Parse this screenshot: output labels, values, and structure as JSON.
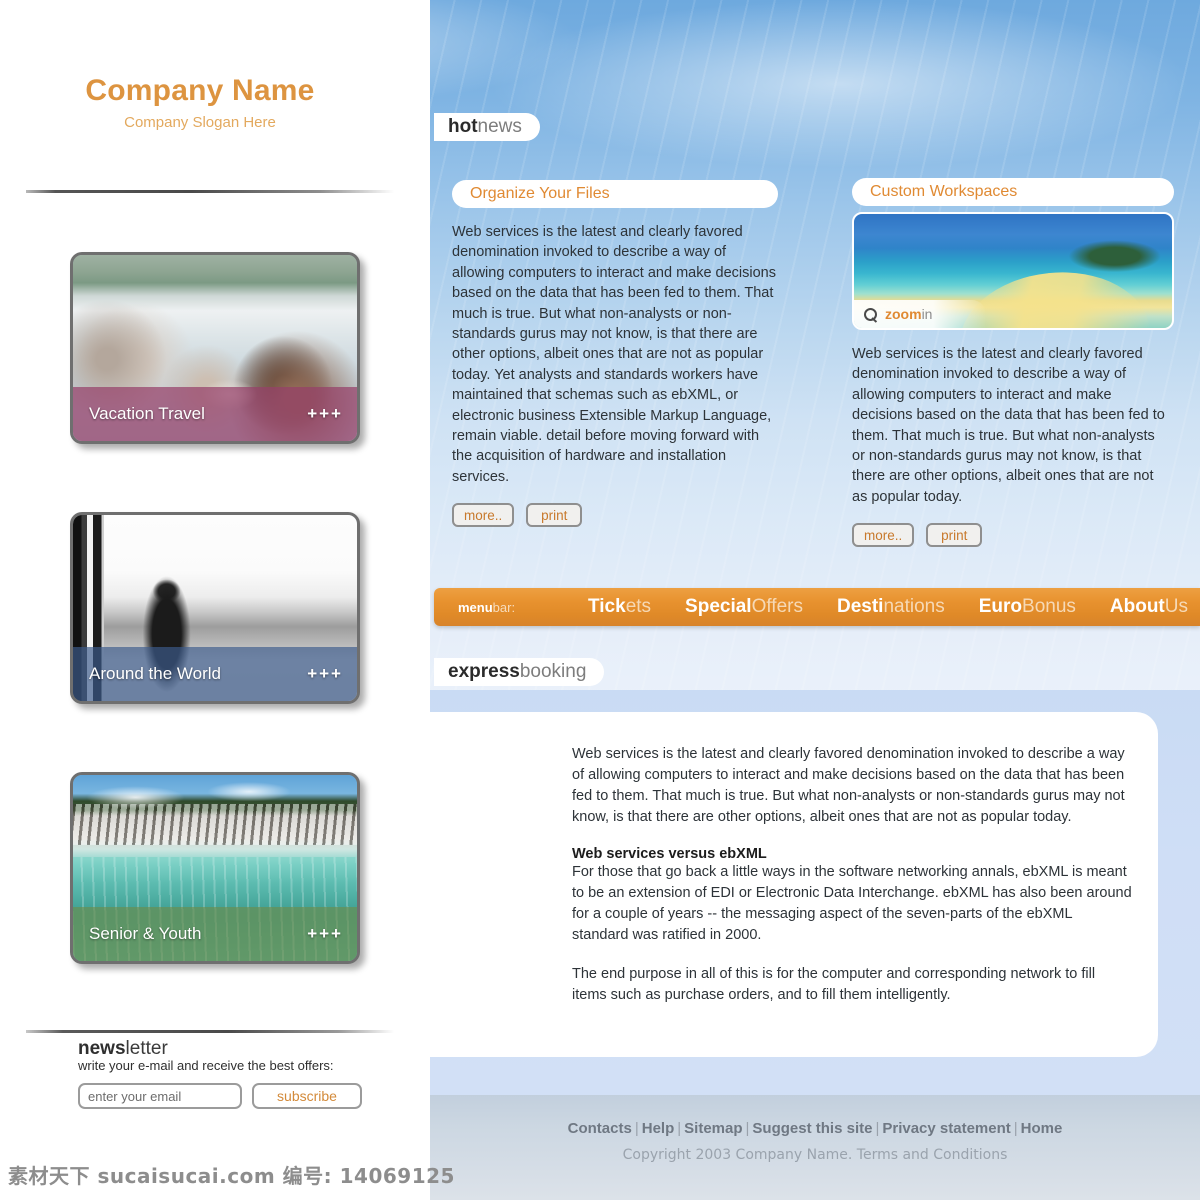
{
  "brand": {
    "name": "Company Name",
    "slogan": "Company Slogan Here",
    "name_color": "#dd9440",
    "slogan_color": "#e3a95e"
  },
  "sidebar": {
    "cards": [
      {
        "label": "Vacation Travel",
        "more": "+++",
        "band_color": "#96406a",
        "image": "lake-with-people-photo"
      },
      {
        "label": "Around the World",
        "more": "+++",
        "band_color": "#3c5c8c",
        "image": "man-at-railing-snow-photo"
      },
      {
        "label": "Senior & Youth",
        "more": "+++",
        "band_color": "#6e8c48",
        "image": "tropical-rocks-turquoise-water-photo"
      }
    ],
    "newsletter": {
      "title_bold": "news",
      "title_rest": "letter",
      "subtitle": "write your e-mail and receive the best offers:",
      "input_value": "enter your email",
      "input_placeholder": "enter your email",
      "button_label": "subscribe",
      "button_color": "#d38a3a"
    }
  },
  "watermark": "素材天下 sucaisucai.com 编号: 14069125",
  "hotnews": {
    "tab_bold": "hot",
    "tab_rest": "news",
    "left": {
      "heading": "Organize Your Files",
      "body": "Web services is the latest and clearly favored denomination invoked to describe a way of allowing computers to interact and make decisions based on the data that has been fed to them. That much is true. But what non-analysts or non-standards gurus may not know, is that there are other options, albeit ones that are not as popular today. Yet analysts and standards workers have maintained that schemas such as ebXML, or electronic business Extensible Markup Language, remain viable. detail before moving forward with the acquisition of hardware and installation services.",
      "more_label": "more..",
      "print_label": "print"
    },
    "right": {
      "heading": "Custom Workspaces",
      "zoom_bold": "zoom",
      "zoom_rest": "in",
      "zoom_icon": "magnifier-icon",
      "body": "Web services is the latest and clearly favored denomination invoked to describe a way of allowing computers to interact and make decisions based on the data that has been fed to them. That much is true. But what non-analysts or non-standards gurus may not know, is that there are other options, albeit ones that are not as popular today.",
      "more_label": "more..",
      "print_label": "print"
    }
  },
  "menubar": {
    "label_bold": "menu",
    "label_rest": "bar:",
    "bg_color": "#e8922f",
    "items": [
      {
        "bold": "Tick",
        "rest": "ets"
      },
      {
        "bold": "Special",
        "rest": "Offers"
      },
      {
        "bold": "Desti",
        "rest": "nations"
      },
      {
        "bold": "Euro",
        "rest": "Bonus"
      },
      {
        "bold": "About",
        "rest": "Us"
      }
    ]
  },
  "express": {
    "tab_bold": "express",
    "tab_rest": "booking",
    "paragraph1": "Web services is the latest and clearly favored denomination invoked to describe a way of allowing computers to interact and make decisions based on the data that has been fed to them. That much is true. But what non-analysts or non-standards gurus may not know, is that there are other options, albeit ones that are not as popular today.",
    "heading": "Web services versus ebXML",
    "paragraph2": "For those that go back a little ways in the software networking annals, ebXML is meant to be an extension of EDI or Electronic Data Interchange. ebXML has also been around for a couple of years -- the messaging aspect of the seven-parts of the ebXML standard was ratified in 2000.",
    "paragraph3": "The end purpose in all of this is for the computer and corresponding network to fill items such as purchase orders, and to fill them intelligently."
  },
  "footer": {
    "links": [
      "Contacts",
      "Help",
      "Sitemap",
      "Suggest this site",
      "Privacy statement",
      "Home"
    ],
    "separator": "|",
    "copyright": "Copyright 2003 Company Name. Terms and Conditions"
  }
}
